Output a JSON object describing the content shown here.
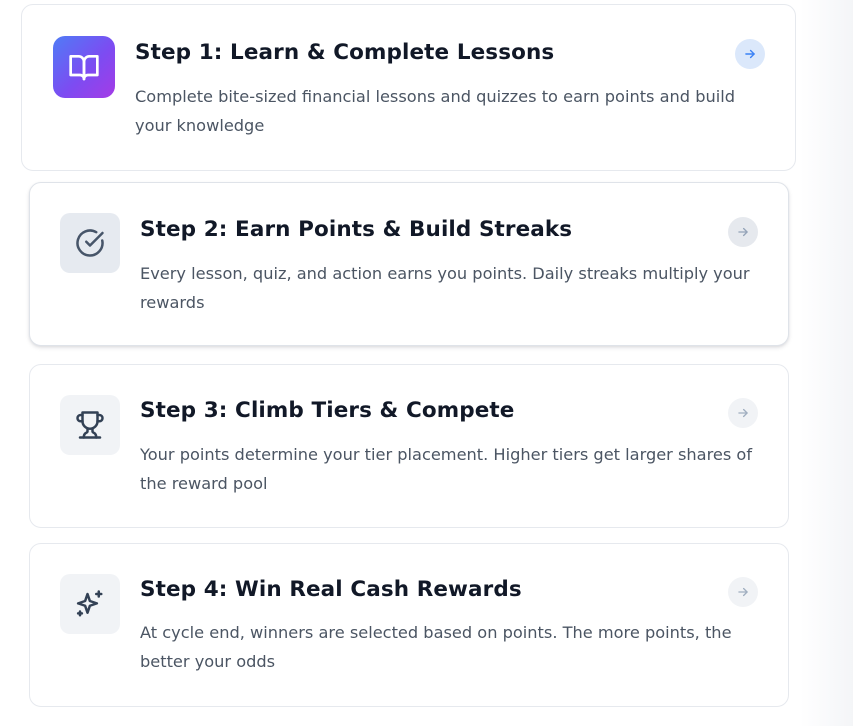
{
  "steps": [
    {
      "title": "Step 1: Learn & Complete Lessons",
      "description": "Complete bite-sized financial lessons and quizzes to earn points and build your knowledge",
      "icon": "book-open-icon"
    },
    {
      "title": "Step 2: Earn Points & Build Streaks",
      "description": "Every lesson, quiz, and action earns you points. Daily streaks multiply your rewards",
      "icon": "check-circle-icon"
    },
    {
      "title": "Step 3: Climb Tiers & Compete",
      "description": "Your points determine your tier placement. Higher tiers get larger shares of the reward pool",
      "icon": "trophy-icon"
    },
    {
      "title": "Step 4: Win Real Cash Rewards",
      "description": "At cycle end, winners are selected based on points. The more points, the better your odds",
      "icon": "sparkles-icon"
    }
  ],
  "colors": {
    "accent_gradient_start": "#4f7cf6",
    "accent_gradient_end": "#a43be6",
    "arrow_active": "#3b82f6",
    "title": "#111827",
    "body_text": "#4b5563"
  }
}
